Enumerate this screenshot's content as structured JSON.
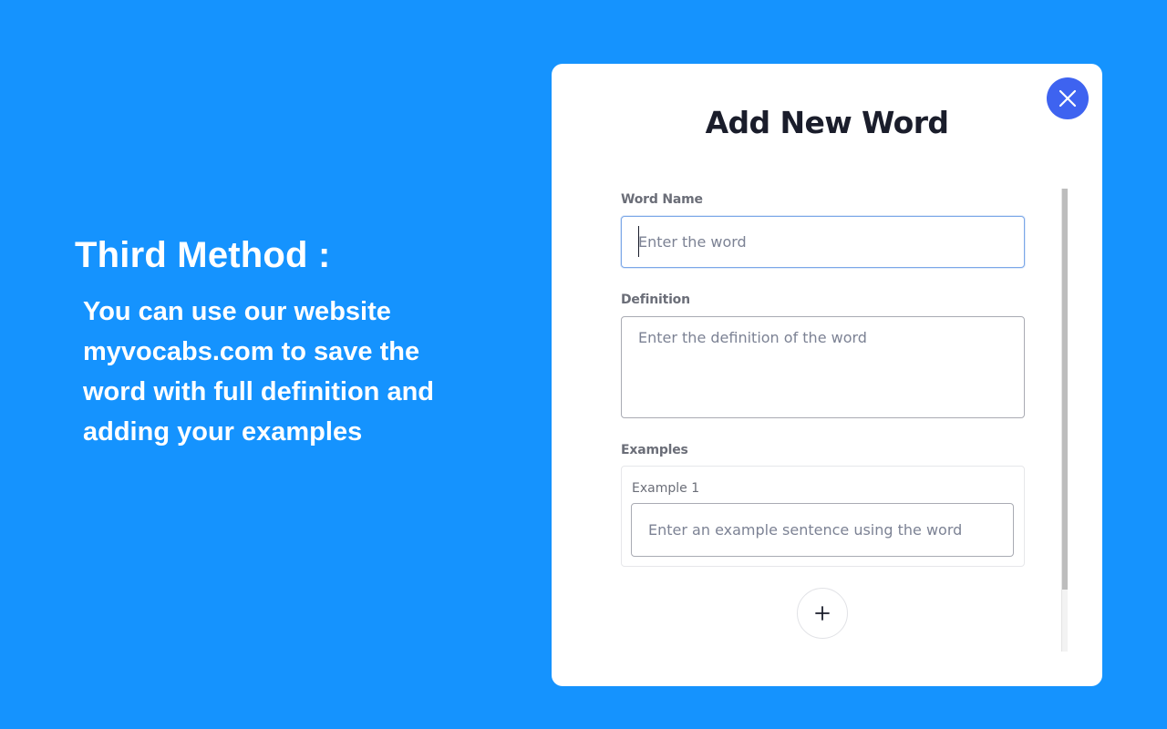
{
  "promo": {
    "title": "Third Method :",
    "body": "You can use our website myvocabs.com to save the word with full definition and adding your examples"
  },
  "modal": {
    "title": "Add New Word",
    "close_icon": "close-icon",
    "word_field": {
      "label": "Word Name",
      "placeholder": "Enter the word",
      "value": ""
    },
    "definition_field": {
      "label": "Definition",
      "placeholder": "Enter the definition of the word",
      "value": ""
    },
    "examples": {
      "label": "Examples",
      "items": [
        {
          "label": "Example 1",
          "placeholder": "Enter an example sentence using the word",
          "value": ""
        }
      ],
      "add_icon": "plus-icon"
    }
  },
  "colors": {
    "background": "#1593fe",
    "close_button": "#3e63f0",
    "title_text": "#1a1d2b",
    "focus_border": "#7ba7e8"
  }
}
